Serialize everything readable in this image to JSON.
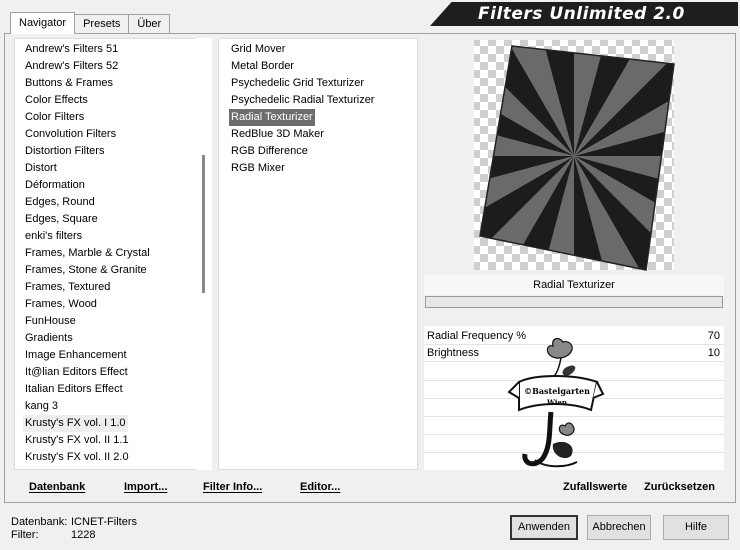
{
  "tabs": [
    {
      "label": "Navigator",
      "active": true
    },
    {
      "label": "Presets",
      "active": false
    },
    {
      "label": "Über",
      "active": false
    }
  ],
  "brand": "Filters Unlimited 2.0",
  "categories": [
    "Andrew's Filters 51",
    "Andrew's Filters 52",
    "Buttons & Frames",
    "Color Effects",
    "Color Filters",
    "Convolution Filters",
    "Distortion Filters",
    "Distort",
    "Déformation",
    "Edges, Round",
    "Edges, Square",
    "enki's filters",
    "Frames, Marble & Crystal",
    "Frames, Stone & Granite",
    "Frames, Textured",
    "Frames, Wood",
    "FunHouse",
    "Gradients",
    "Image Enhancement",
    "It@lian Editors Effect",
    "Italian Editors Effect",
    "kang 3",
    "Krusty's FX vol. I 1.0",
    "Krusty's FX vol. II 1.1",
    "Krusty's FX vol. II 2.0"
  ],
  "selected_category_index": 22,
  "filters": [
    "Grid Mover",
    "Metal Border",
    "Psychedelic Grid Texturizer",
    "Psychedelic Radial Texturizer",
    "Radial Texturizer",
    "RedBlue 3D Maker",
    "RGB Difference",
    "RGB Mixer"
  ],
  "selected_filter_index": 4,
  "preview": {
    "filter_name": "Radial Texturizer"
  },
  "params": [
    {
      "name": "Radial Frequency %",
      "value": "70"
    },
    {
      "name": "Brightness",
      "value": "10"
    }
  ],
  "watermark": {
    "line1": "©Bastelgarten",
    "line2": "Wien"
  },
  "toolbar": {
    "database": "Datenbank",
    "import": "Import...",
    "filter_info": "Filter Info...",
    "editor": "Editor...",
    "random": "Zufallswerte",
    "reset": "Zurücksetzen"
  },
  "info": {
    "db_label": "Datenbank:",
    "db_value": "ICNET-Filters",
    "filter_label": "Filter:",
    "filter_value": "1228"
  },
  "buttons": {
    "apply": "Anwenden",
    "cancel": "Abbrechen",
    "help": "Hilfe"
  }
}
